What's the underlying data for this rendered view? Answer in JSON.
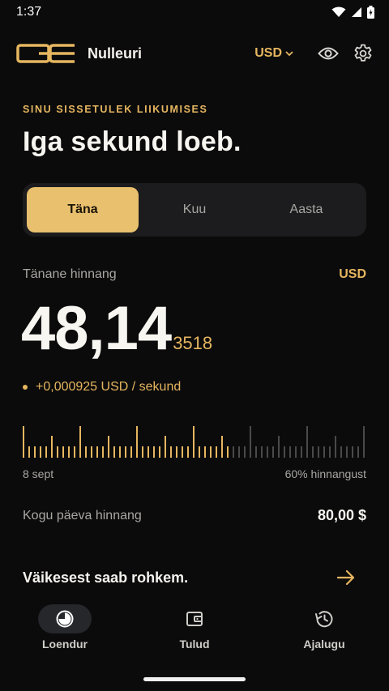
{
  "status_bar": {
    "time": "1:37"
  },
  "header": {
    "app_name": "Nulleuri",
    "currency": "USD"
  },
  "hero": {
    "eyebrow": "SINU SISSETULEK LIIKUMISES",
    "title": "Iga sekund loeb."
  },
  "tabs": [
    {
      "label": "Täna",
      "active": true
    },
    {
      "label": "Kuu",
      "active": false
    },
    {
      "label": "Aasta",
      "active": false
    }
  ],
  "rate": {
    "label": "Tänane hinnang",
    "currency": "USD",
    "value_main": "48,14",
    "value_decimals": "3518",
    "per_second": "+0,000925 USD / sekund"
  },
  "progress": {
    "date_label": "8 sept",
    "percent_label": "60% hinnangust",
    "fraction": 0.6
  },
  "total": {
    "label": "Kogu päeva hinnang",
    "value": "80,00 $"
  },
  "promo": {
    "text": "Väikesest saab rohkem."
  },
  "nav": [
    {
      "label": "Loendur",
      "icon": "counter-icon",
      "active": true
    },
    {
      "label": "Tulud",
      "icon": "wallet-icon",
      "active": false
    },
    {
      "label": "Ajalugu",
      "icon": "history-icon",
      "active": false
    }
  ],
  "colors": {
    "accent": "#e6b660",
    "background": "#0b0b0b",
    "tick_active": "#e6b660",
    "tick_inactive": "#4a4a4a"
  }
}
